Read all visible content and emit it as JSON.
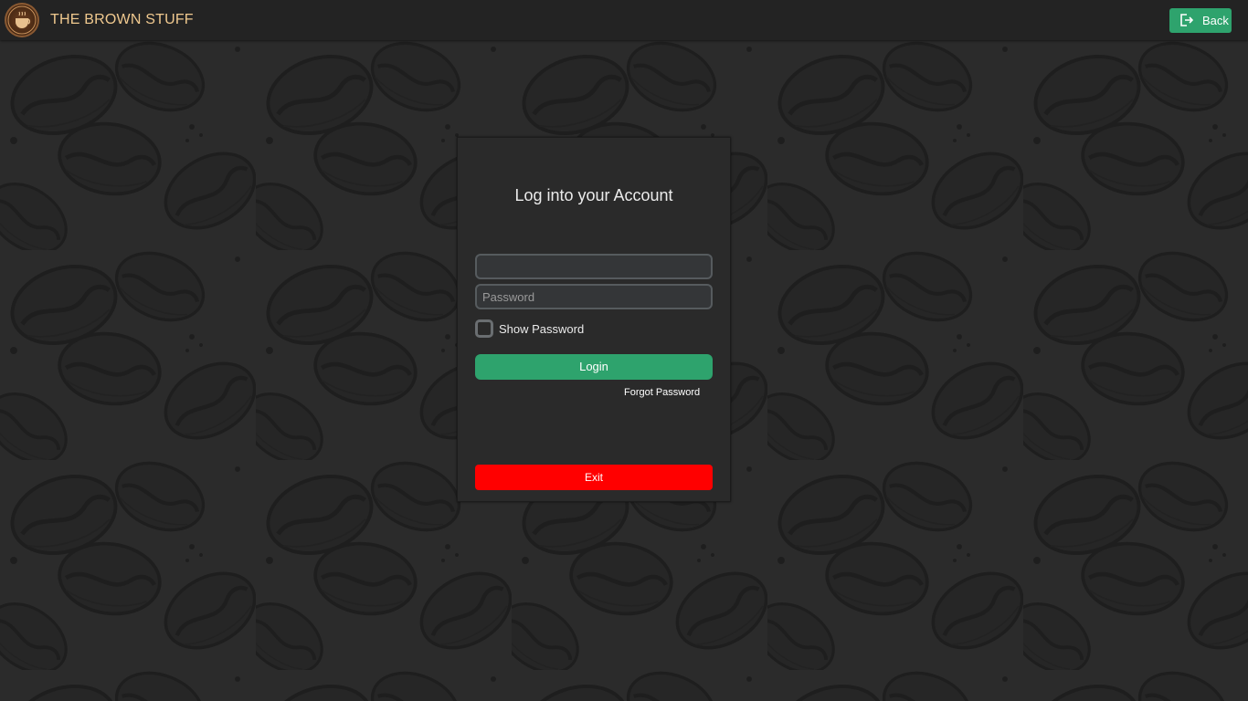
{
  "app": {
    "title": "THE BROWN STUFF",
    "logo_icon": "coffee-cup-logo",
    "back_label": "Back",
    "back_icon": "sign-out-icon"
  },
  "login": {
    "title": "Log into your Account",
    "username_value": "",
    "username_placeholder": "",
    "password_value": "",
    "password_placeholder": "Password",
    "show_password_label": "Show Password",
    "show_password_checked": false,
    "login_label": "Login",
    "forgot_label": "Forgot Password",
    "exit_label": "Exit"
  },
  "colors": {
    "background": "#2b2b2b",
    "topbar": "#232323",
    "accent_green": "#2ea36d",
    "danger_red": "#ff0000",
    "brand_text": "#f0c98f"
  }
}
